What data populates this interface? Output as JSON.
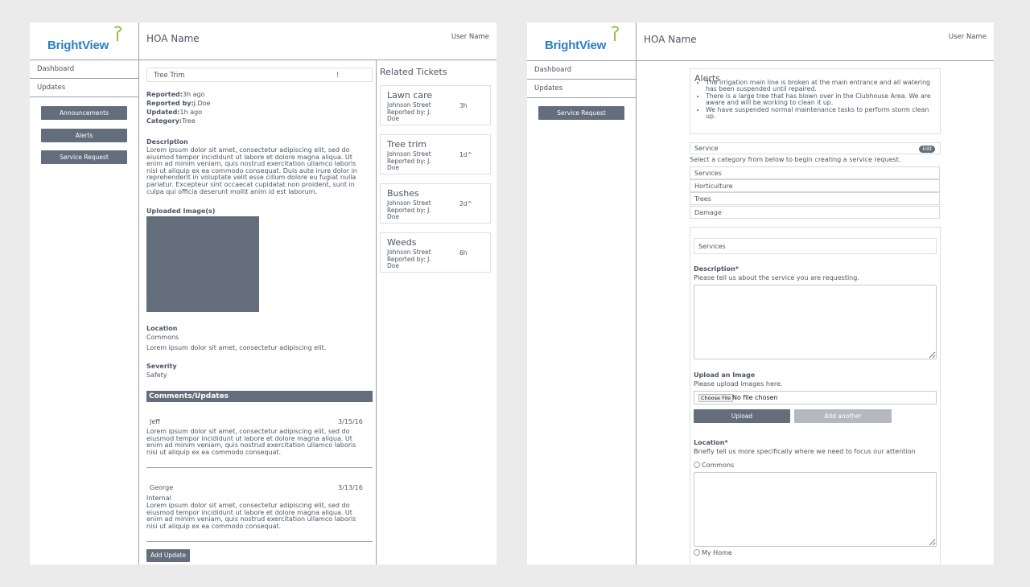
{
  "brand": {
    "logo_text": "BrightView",
    "accent": "#2b7fc2",
    "leaf_color": "#8dc63f"
  },
  "left": {
    "header": {
      "hoa_name": "HOA Name",
      "user_name": "User Name"
    },
    "nav": [
      {
        "label": "Dashboard"
      },
      {
        "label": "Updates"
      }
    ],
    "sidebar_buttons": [
      {
        "label": "Announcements"
      },
      {
        "label": "Alerts"
      },
      {
        "label": "Service Request"
      }
    ],
    "ticket": {
      "title": "Tree Trim",
      "flag": "!",
      "reported_label": "Reported:",
      "reported_value": "3h ago",
      "reported_by_label": "Reported by:",
      "reported_by_value": "J.Doe",
      "updated_label": "Updated:",
      "updated_value": "1h ago",
      "category_label": "Category:",
      "category_value": "Tree",
      "description_label": "Description",
      "description": "Lorem ipsum dolor sit amet, consectetur adipiscing elit, sed do eiusmod tempor incididunt ut labore et dolore magna aliqua. Ut enim ad minim veniam, quis nostrud exercitation ullamco laboris nisi ut aliquip ex ea commodo consequat. Duis aute irure dolor in reprehenderit in voluptate velit esse cillum dolore eu fugiat nulla pariatur. Excepteur sint occaecat cupidatat non proident, sunt in culpa qui officia deserunt mollit anim id est laborum.",
      "images_label": "Uploaded Image(s)",
      "location_label": "Location",
      "location_value": "Commons",
      "location_note": "Lorem ipsum dolor sit amet, consectetur adipiscing elit.",
      "severity_label": "Severity",
      "severity_value": "Safety"
    },
    "comments_header": "Comments/Updates",
    "comments": [
      {
        "author": "Jeff",
        "date": "3/15/16",
        "tag": "",
        "text": "Lorem ipsum dolor sit amet, consectetur adipiscing elit, sed do eiusmod tempor incididunt ut labore et dolore magna aliqua. Ut enim ad minim veniam, quis nostrud exercitation ullamco laboris nisi ut aliquip ex ea commodo consequat."
      },
      {
        "author": "George",
        "date": "3/13/16",
        "tag": "Internal",
        "text": "Lorem ipsum dolor sit amet, consectetur adipiscing elit, sed do eiusmod tempor incididunt ut labore et dolore magna aliqua. Ut enim ad minim veniam, quis nostrud exercitation ullamco laboris nisi ut aliquip ex ea commodo consequat."
      }
    ],
    "add_update_label": "Add Update",
    "related_title": "Related Tickets",
    "related": [
      {
        "title": "Lawn care",
        "street": "Johnson Street",
        "reporter": "Reported by: J. Doe",
        "meta": "3h"
      },
      {
        "title": "Tree trim",
        "street": "Johnson Street",
        "reporter": "Reported by: J. Doe",
        "meta": "1d^"
      },
      {
        "title": "Bushes",
        "street": "Johnson Street",
        "reporter": "Reported by: J. Doe",
        "meta": "2d^"
      },
      {
        "title": "Weeds",
        "street": "Johnson Street",
        "reporter": "Reported by: J. Doe",
        "meta": "6h"
      }
    ]
  },
  "right": {
    "header": {
      "hoa_name": "HOA Name",
      "user_name": "User Name"
    },
    "nav": [
      {
        "label": "Dashboard"
      },
      {
        "label": "Updates"
      }
    ],
    "sidebar_button": "Service Request",
    "alerts": {
      "title": "Alerts",
      "items": [
        "The irrigation main line is broken at the main entrance and all watering has been suspended until repaired.",
        "There is a large tree that has blown over in the Clubhouse Area. We are aware and will be working to clean it up.",
        "We have suspended normal maintenance tasks to perform storm clean up."
      ]
    },
    "service": {
      "label": "Service",
      "edit_label": "Edit",
      "hint": "Select a category from below to begin creating a service request.",
      "categories": [
        "Services",
        "Horticulture",
        "Trees",
        "Damage"
      ]
    },
    "form": {
      "selected_category": "Services",
      "description_label": "Description*",
      "description_hint": "Please tell us about the service you are requesting.",
      "upload_label": "Upload an Image",
      "upload_hint": "Please upload images here.",
      "choose_file": "Choose File",
      "no_file": "No file chosen",
      "upload_button": "Upload",
      "add_another_button": "Add another",
      "location_label": "Location*",
      "location_hint": "Briefly tell us more specifically where we need to focus our attention",
      "option_commons": "Commons",
      "option_home": "My Home"
    }
  }
}
